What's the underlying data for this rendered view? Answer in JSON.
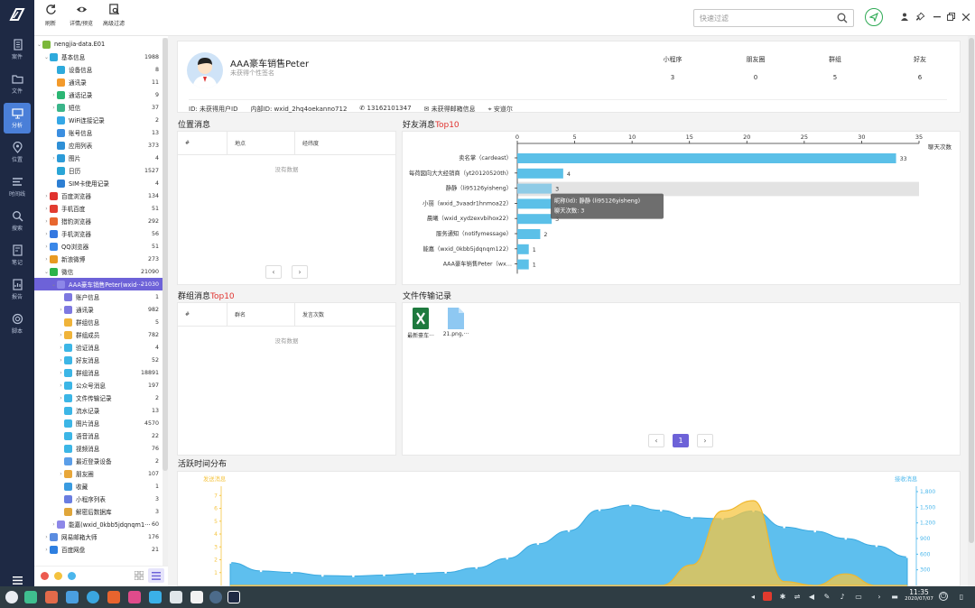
{
  "leftbar": {
    "items": [
      {
        "label": "案件",
        "icon": "file-text-icon"
      },
      {
        "label": "文件",
        "icon": "folder-icon"
      },
      {
        "label": "分析",
        "icon": "monitor-icon",
        "active": true
      },
      {
        "label": "位置",
        "icon": "location-pin-icon"
      },
      {
        "label": "时间线",
        "icon": "timeline-icon"
      },
      {
        "label": "搜索",
        "icon": "search-icon"
      },
      {
        "label": "笔记",
        "icon": "note-icon"
      },
      {
        "label": "报告",
        "icon": "report-icon"
      },
      {
        "label": "脚本",
        "icon": "script-icon"
      }
    ]
  },
  "toolbar": {
    "refresh_label": "刷新",
    "detail_label": "详情/预览",
    "filter_label": "高级过滤",
    "search_placeholder": "快速过滤"
  },
  "tree": [
    {
      "label": "nengjia-data.E01",
      "count": "",
      "level": 0,
      "color": "#7bb83a",
      "expanded": true
    },
    {
      "label": "基本信息",
      "count": "1988",
      "level": 1,
      "color": "#2eaadc",
      "expanded": true
    },
    {
      "label": "设备信息",
      "count": "8",
      "level": 2,
      "color": "#2eaadc"
    },
    {
      "label": "通讯录",
      "count": "11",
      "level": 2,
      "color": "#f39a2b"
    },
    {
      "label": "通话记录",
      "count": "9",
      "level": 2,
      "color": "#2bb673",
      "arrow": true
    },
    {
      "label": "短信",
      "count": "37",
      "level": 2,
      "color": "#3bb58a",
      "arrow": true
    },
    {
      "label": "WiFi连接记录",
      "count": "2",
      "level": 2,
      "color": "#35a7e6"
    },
    {
      "label": "账号信息",
      "count": "13",
      "level": 2,
      "color": "#3b8ee0"
    },
    {
      "label": "应用列表",
      "count": "373",
      "level": 2,
      "color": "#2e8fd6"
    },
    {
      "label": "图片",
      "count": "4",
      "level": 2,
      "color": "#2c9bd8",
      "arrow": true
    },
    {
      "label": "日历",
      "count": "1527",
      "level": 2,
      "color": "#2aa5d6"
    },
    {
      "label": "SIM卡使用记录",
      "count": "4",
      "level": 2,
      "color": "#2d7fd3"
    },
    {
      "label": "百度浏览器",
      "count": "134",
      "level": 1,
      "color": "#e0322f",
      "arrow": true
    },
    {
      "label": "手机百度",
      "count": "51",
      "level": 1,
      "color": "#e23c30",
      "arrow": true
    },
    {
      "label": "猎豹浏览器",
      "count": "292",
      "level": 1,
      "color": "#e8672f",
      "arrow": true
    },
    {
      "label": "手机浏览器",
      "count": "56",
      "level": 1,
      "color": "#3478e0",
      "arrow": true
    },
    {
      "label": "QQ浏览器",
      "count": "51",
      "level": 1,
      "color": "#3a87e8",
      "arrow": true
    },
    {
      "label": "新浪微博",
      "count": "273",
      "level": 1,
      "color": "#e89a22",
      "arrow": true
    },
    {
      "label": "微信",
      "count": "21090",
      "level": 1,
      "color": "#2bb34a",
      "expanded": true
    },
    {
      "label": "AAA豪车销售Peter(wxid···",
      "count": "21030",
      "level": 2,
      "color": "#8d87e8",
      "expanded": true,
      "selected": true
    },
    {
      "label": "账户信息",
      "count": "1",
      "level": 3,
      "color": "#7d78e0"
    },
    {
      "label": "通讯录",
      "count": "982",
      "level": 3,
      "color": "#7d78e0",
      "arrow": true
    },
    {
      "label": "群组信息",
      "count": "5",
      "level": 3,
      "color": "#f0b43a"
    },
    {
      "label": "群组成员",
      "count": "782",
      "level": 3,
      "color": "#f0b43a",
      "arrow": true
    },
    {
      "label": "验证消息",
      "count": "4",
      "level": 3,
      "color": "#3cb6e6",
      "arrow": true
    },
    {
      "label": "好友消息",
      "count": "52",
      "level": 3,
      "color": "#3cb6e6",
      "arrow": true
    },
    {
      "label": "群组消息",
      "count": "18891",
      "level": 3,
      "color": "#3cb6e6",
      "arrow": true
    },
    {
      "label": "公众号消息",
      "count": "197",
      "level": 3,
      "color": "#3cb6e6",
      "arrow": true
    },
    {
      "label": "文件传输记录",
      "count": "2",
      "level": 3,
      "color": "#3cb6e6",
      "arrow": true
    },
    {
      "label": "流水记录",
      "count": "13",
      "level": 3,
      "color": "#3cb6e6"
    },
    {
      "label": "图片消息",
      "count": "4570",
      "level": 3,
      "color": "#3cb6e6"
    },
    {
      "label": "语音消息",
      "count": "22",
      "level": 3,
      "color": "#3cb6e6"
    },
    {
      "label": "视频消息",
      "count": "76",
      "level": 3,
      "color": "#3cb6e6"
    },
    {
      "label": "最近登录设备",
      "count": "2",
      "level": 3,
      "color": "#5b9ee8"
    },
    {
      "label": "朋友圈",
      "count": "107",
      "level": 3,
      "color": "#e8a73a",
      "arrow": true
    },
    {
      "label": "收藏",
      "count": "1",
      "level": 3,
      "color": "#3a9be0"
    },
    {
      "label": "小程序列表",
      "count": "3",
      "level": 3,
      "color": "#6a7de0"
    },
    {
      "label": "解密后数据库",
      "count": "3",
      "level": 3,
      "color": "#e0a63a"
    },
    {
      "label": "能嘉(wxid_0kbb5jdqnqm1···",
      "count": "60",
      "level": 2,
      "color": "#8d87e8",
      "arrow": true
    },
    {
      "label": "网易邮箱大师",
      "count": "176",
      "level": 1,
      "color": "#5a8ce0",
      "arrow": true
    },
    {
      "label": "百度网盘",
      "count": "21",
      "level": 1,
      "color": "#2e7fe0",
      "arrow": true
    }
  ],
  "profile": {
    "name": "AAA豪车销售Peter",
    "signature": "未获得个性签名",
    "stats": [
      {
        "label": "小程序",
        "value": "3"
      },
      {
        "label": "朋友圈",
        "value": "0"
      },
      {
        "label": "群组",
        "value": "5"
      },
      {
        "label": "好友",
        "value": "6"
      }
    ],
    "id": "ID: 未获得用户ID",
    "inner_id": "内部ID: wxid_2hq4oekanno712",
    "phone": "13162101347",
    "email": "未获得邮箱信息",
    "location": "安道尔"
  },
  "location_panel": {
    "title": "位置消息",
    "cols": [
      "#",
      "地点",
      "经纬度"
    ],
    "empty": "没有数据"
  },
  "group_panel": {
    "title": "群组消息",
    "title_suffix": "Top10",
    "cols": [
      "#",
      "群名",
      "发言次数"
    ],
    "empty": "没有数据"
  },
  "friend_panel": {
    "title": "好友消息",
    "title_suffix": "Top10"
  },
  "file_panel": {
    "title": "文件传输记录",
    "files": [
      {
        "name": "最新豪车···",
        "icon": "excel-file-icon"
      },
      {
        "name": "21.png,···",
        "icon": "image-file-icon"
      }
    ],
    "page": "1"
  },
  "activity_panel": {
    "title": "活跃时间分布",
    "left_label": "发送消息",
    "right_label": "接收消息"
  },
  "tooltip": {
    "line1": "昵称(Id): 静静 (li95126yisheng)",
    "line2": "聊天次数: 3"
  },
  "taskbar": {
    "time": "11:35",
    "date": "2020/07/07"
  },
  "chart_data": [
    {
      "type": "bar",
      "orientation": "horizontal",
      "categories": [
        "卖名掌（cardeast）",
        "每荷図向大大经销商（yt20120520th）",
        "静静（li95126yisheng）",
        "小丽（wxid_3vaadr1hnmoa22）",
        "晨曦（wxid_xydzexvbihox22）",
        "服务通知（notifymessage）",
        "能嘉（wxid_0kbb5jdqnqm122）",
        "AAA豪车销售Peter（wx…"
      ],
      "values": [
        33,
        4,
        3,
        3,
        3,
        2,
        1,
        1
      ],
      "xlabel": "聊天次数",
      "xlim": [
        0,
        35
      ],
      "xticks": [
        0,
        5,
        10,
        15,
        20,
        25,
        30,
        35
      ],
      "highlight_index": 2
    },
    {
      "type": "area",
      "series": [
        {
          "name": "发送消息",
          "axis": "left",
          "color": "#f5c542"
        },
        {
          "name": "接收消息",
          "axis": "right",
          "color": "#4db8ec"
        }
      ],
      "left_ticks": [
        "1",
        "2",
        "3",
        "4",
        "5",
        "6",
        "7"
      ],
      "right_ticks": [
        "300",
        "600",
        "900",
        "1,200",
        "1,500",
        "1,800"
      ],
      "ylim_left": [
        0,
        7.3
      ],
      "ylim_right": [
        0,
        1800
      ],
      "received": [
        440,
        280,
        250,
        190,
        180,
        200,
        230,
        250,
        340,
        520,
        800,
        1050,
        1450,
        1540,
        1440,
        1300,
        1280,
        1430,
        1120,
        1040,
        900,
        760,
        550
      ],
      "sent": [
        0,
        0,
        0,
        0,
        0,
        0,
        0,
        0,
        0,
        0,
        0,
        0,
        0,
        0,
        0,
        1.6,
        5.8,
        6.6,
        0.3,
        0,
        0.9,
        0,
        0
      ]
    }
  ]
}
